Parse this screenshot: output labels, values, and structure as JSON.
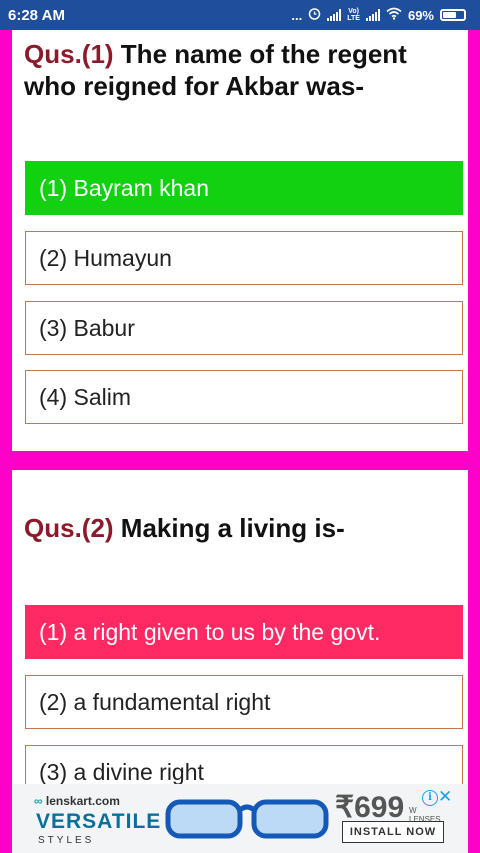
{
  "status_bar": {
    "time": "6:28 AM",
    "dots": "...",
    "volte": [
      "Vo)",
      "LTE"
    ],
    "battery_percent": "69%",
    "battery_level": 0.69
  },
  "question1": {
    "number": "Qus.(1)",
    "text": " The name of the regent who reigned for Akbar was-",
    "options": [
      {
        "label": "(1) Bayram khan",
        "state": "correct"
      },
      {
        "label": "(2) Humayun",
        "state": "normal"
      },
      {
        "label": "(3) Babur",
        "state": "normal"
      },
      {
        "label": "(4) Salim",
        "state": "normal"
      }
    ]
  },
  "question2": {
    "number": "Qus.(2)",
    "text": " Making a living is-",
    "options": [
      {
        "label": "(1) a right given to us by the govt.",
        "state": "wrong"
      },
      {
        "label": "(2) a fundamental right",
        "state": "normal"
      },
      {
        "label": "(3) a divine right",
        "state": "normal"
      }
    ]
  },
  "ad": {
    "brand": "lenskart.com",
    "headline": "VERSATILE",
    "sub": "STYLES",
    "price": "₹699",
    "lenses_top": "W",
    "lenses_bottom": "LENSES",
    "install": "INSTALL NOW",
    "info": "i",
    "close": "✕"
  },
  "colors": {
    "status_bar": "#1f4f9c",
    "page_background": "#ff00c8",
    "correct": "#11d111",
    "wrong": "#ff2a63",
    "question_number": "#8b1a2b",
    "option_border": "#c8764f"
  }
}
